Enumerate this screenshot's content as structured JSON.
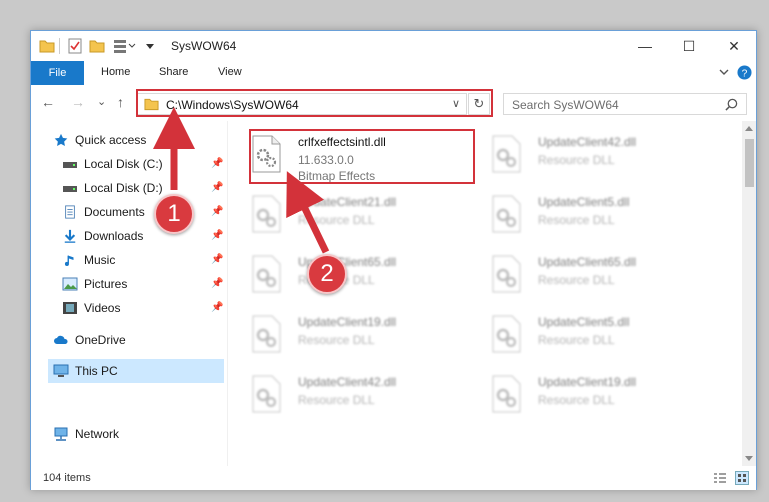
{
  "window": {
    "title": "SysWOW64",
    "minimize_glyph": "—",
    "maximize_glyph": "☐",
    "close_glyph": "✕"
  },
  "ribbon": {
    "tabs": [
      "File",
      "Home",
      "Share",
      "View"
    ]
  },
  "navigation": {
    "back_glyph": "←",
    "forward_glyph": "→",
    "recent_glyph": "⌄",
    "up_glyph": "↑"
  },
  "address": {
    "path": "C:\\Windows\\SysWOW64",
    "dropdown_glyph": "∨",
    "refresh_glyph": "↻"
  },
  "search": {
    "placeholder": "Search SysWOW64"
  },
  "sidebar": {
    "quick_access": "Quick access",
    "items": [
      {
        "label": "Local Disk (C:)",
        "icon": "drive-icon"
      },
      {
        "label": "Local Disk (D:)",
        "icon": "drive-icon"
      },
      {
        "label": "Documents",
        "icon": "documents-icon"
      },
      {
        "label": "Downloads",
        "icon": "download-icon"
      },
      {
        "label": "Music",
        "icon": "music-icon"
      },
      {
        "label": "Pictures",
        "icon": "pictures-icon"
      },
      {
        "label": "Videos",
        "icon": "videos-icon"
      }
    ],
    "onedrive": "OneDrive",
    "this_pc": "This PC",
    "network": "Network"
  },
  "files": [
    {
      "name": "crlfxeffectsintl.dll",
      "version": "11.633.0.0",
      "description": "Bitmap Effects",
      "highlighted": true
    },
    {
      "name": "UpdateClient42.dll",
      "description": "Resource DLL"
    },
    {
      "name": "UpdateClient21.dll",
      "description": "Resource DLL"
    },
    {
      "name": "UpdateClient5.dll",
      "description": "Resource DLL"
    },
    {
      "name": "UpdateClient65.dll",
      "description": "Resource DLL"
    },
    {
      "name": "UpdateClient65.dll",
      "description": "Resource DLL"
    },
    {
      "name": "UpdateClient19.dll",
      "description": "Resource DLL"
    },
    {
      "name": "UpdateClient5.dll",
      "description": "Resource DLL"
    },
    {
      "name": "UpdateClient42.dll",
      "description": "Resource DLL"
    },
    {
      "name": "UpdateClient19.dll",
      "description": "Resource DLL"
    }
  ],
  "status": {
    "item_count": "104 items"
  },
  "annotations": {
    "step1": "1",
    "step2": "2",
    "color": "#d3323a"
  }
}
